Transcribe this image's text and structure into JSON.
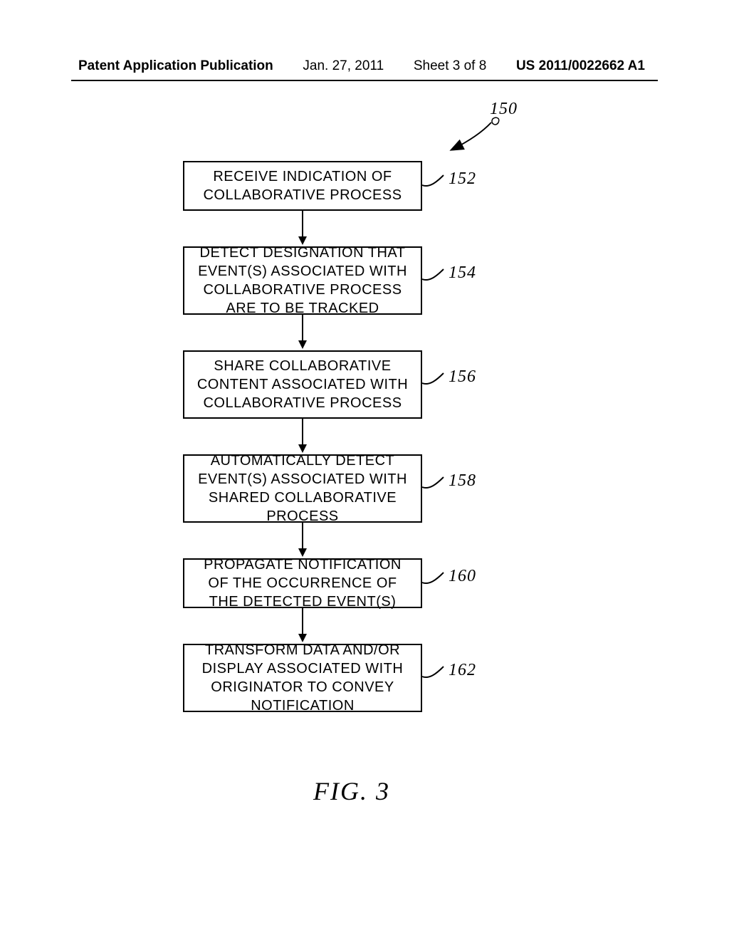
{
  "header": {
    "publication_type": "Patent Application Publication",
    "date": "Jan. 27, 2011",
    "sheet": "Sheet 3 of 8",
    "pub_number": "US 2011/0022662 A1"
  },
  "diagram_ref": "150",
  "steps": [
    {
      "ref": "152",
      "text": "RECEIVE INDICATION OF COLLABORATIVE PROCESS"
    },
    {
      "ref": "154",
      "text": "DETECT DESIGNATION THAT EVENT(S) ASSOCIATED WITH COLLABORATIVE PROCESS ARE TO BE TRACKED"
    },
    {
      "ref": "156",
      "text": "SHARE COLLABORATIVE CONTENT ASSOCIATED WITH COLLABORATIVE PROCESS"
    },
    {
      "ref": "158",
      "text": "AUTOMATICALLY DETECT EVENT(S) ASSOCIATED WITH SHARED COLLABORATIVE PROCESS"
    },
    {
      "ref": "160",
      "text": "PROPAGATE NOTIFICATION OF THE OCCURRENCE OF THE DETECTED EVENT(S)"
    },
    {
      "ref": "162",
      "text": "TRANSFORM DATA AND/OR DISPLAY ASSOCIATED WITH ORIGINATOR TO CONVEY NOTIFICATION"
    }
  ],
  "figure_label": "FIG. 3"
}
